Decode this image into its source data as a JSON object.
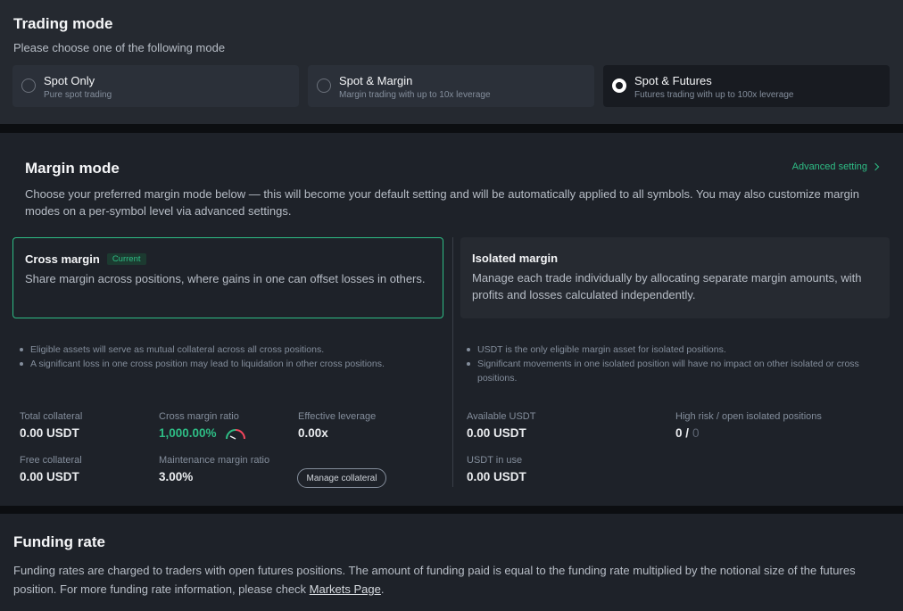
{
  "trading_mode": {
    "title": "Trading mode",
    "subtitle": "Please choose one of the following mode",
    "options": [
      {
        "name": "Spot Only",
        "desc": "Pure spot trading",
        "selected": false
      },
      {
        "name": "Spot & Margin",
        "desc": "Margin trading with up to 10x leverage",
        "selected": false
      },
      {
        "name": "Spot & Futures",
        "desc": "Futures trading with up to 100x leverage",
        "selected": true
      }
    ]
  },
  "margin_mode": {
    "title": "Margin mode",
    "advanced_link": "Advanced setting",
    "description": "Choose your preferred margin mode below — this will become your default setting and will be automatically applied to all symbols. You may also customize margin modes on a per-symbol level via advanced settings.",
    "cross": {
      "title": "Cross margin",
      "badge": "Current",
      "text": "Share margin across positions, where gains in one can offset losses in others.",
      "bullets": [
        "Eligible assets will serve as mutual collateral across all cross positions.",
        "A significant loss in one cross position may lead to liquidation in other cross positions."
      ],
      "stats": {
        "total_collateral_label": "Total collateral",
        "total_collateral_value": "0.00 USDT",
        "cross_ratio_label": "Cross margin ratio",
        "cross_ratio_value": "1,000.00%",
        "effective_leverage_label": "Effective leverage",
        "effective_leverage_value": "0.00x",
        "free_collateral_label": "Free collateral",
        "free_collateral_value": "0.00 USDT",
        "maintenance_label": "Maintenance margin ratio",
        "maintenance_value": "3.00%"
      },
      "manage_button": "Manage collateral"
    },
    "isolated": {
      "title": "Isolated margin",
      "text": "Manage each trade individually by allocating separate margin amounts, with profits and losses calculated independently.",
      "bullets": [
        "USDT is the only eligible margin asset for isolated positions.",
        "Significant movements in one isolated position will have no impact on other isolated or cross positions."
      ],
      "stats": {
        "available_label": "Available USDT",
        "available_value": "0.00 USDT",
        "high_risk_label": "High risk / open isolated positions",
        "high_risk_count": "0 /",
        "open_count": "0",
        "in_use_label": "USDT in use",
        "in_use_value": "0.00 USDT"
      }
    }
  },
  "funding_rate": {
    "title": "Funding rate",
    "text": "Funding rates are charged to traders with open futures positions. The amount of funding paid is equal to the funding rate multiplied by the notional size of the futures position. For more funding rate information, please check ",
    "link": "Markets Page",
    "tail": "."
  },
  "colors": {
    "accent": "#2ebd85",
    "gauge_red": "#f6465d"
  }
}
